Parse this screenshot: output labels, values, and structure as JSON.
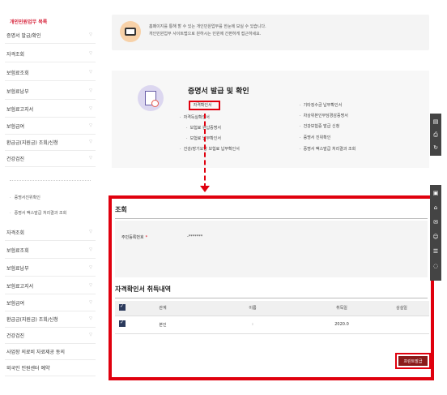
{
  "sidebar": {
    "top_title": "개인민원업무 목록",
    "top_items": [
      {
        "label": "증명서 발급/확인"
      },
      {
        "label": "자격조회"
      },
      {
        "label": "보험료조회"
      },
      {
        "label": "보험료납부"
      },
      {
        "label": "보험료고지서"
      },
      {
        "label": "보험급여"
      },
      {
        "label": "환급금(지원금) 조회/신청"
      },
      {
        "label": "건강검진"
      }
    ],
    "sub_items": [
      {
        "label": "증명서진위확인"
      },
      {
        "label": "증명서 팩스발급 처리결과 조회"
      }
    ],
    "bottom_items": [
      {
        "label": "자격조회"
      },
      {
        "label": "보험료조회"
      },
      {
        "label": "보험료납부"
      },
      {
        "label": "보험료고지서"
      },
      {
        "label": "보험급여"
      },
      {
        "label": "환급금(지원금) 조회/신청"
      },
      {
        "label": "건강검진"
      },
      {
        "label": "사업장 의료비 자료제공 동의"
      },
      {
        "label": "외국인 민원센터 예약"
      }
    ]
  },
  "info_bar": {
    "line1": "홈페이지를 통해 할 수 있는 개인민원업무를 한눈에 보실 수 있습니다.",
    "line2": "개인민원업무 사이트맵으로 원하시는 민원에 간편하게 접근하세요."
  },
  "cert_menu": {
    "title": "증명서 발급 및 확인",
    "left_links": [
      "자격확인서",
      "자격득실확인서",
      "보험료 완납증명서",
      "보험료 납부확인서",
      "건강/장기요양 보험료 납부확인서"
    ],
    "right_links": [
      "기타징수금 납부확인서",
      "차상위본인부담경감증명서",
      "건강보험증 발급 신청",
      "증명서 진위확인",
      "증명서 팩스발급 처리결과 조회"
    ]
  },
  "inquiry": {
    "title": "조회",
    "rrn_label": "주민등록번호",
    "rrn_required_mark": "*",
    "rrn_value": "-*******"
  },
  "history": {
    "title": "자격확인서 취득내역",
    "columns": [
      "관계",
      "이름",
      "취득일",
      "상실일"
    ],
    "rows": [
      {
        "relation": "본인",
        "name": ":",
        "acquired": "2020.0",
        "lost": ""
      }
    ]
  },
  "print_button": {
    "label": "프린트발급"
  },
  "colors": {
    "highlight": "#e0000e",
    "accent": "#d7263d",
    "button_bg": "#8b1a1a"
  },
  "quick_menu_icons": [
    "document-icon",
    "print-icon",
    "refresh-icon",
    "card-icon",
    "home-icon",
    "mail-icon",
    "user-icon",
    "list-icon",
    "chat-icon"
  ]
}
